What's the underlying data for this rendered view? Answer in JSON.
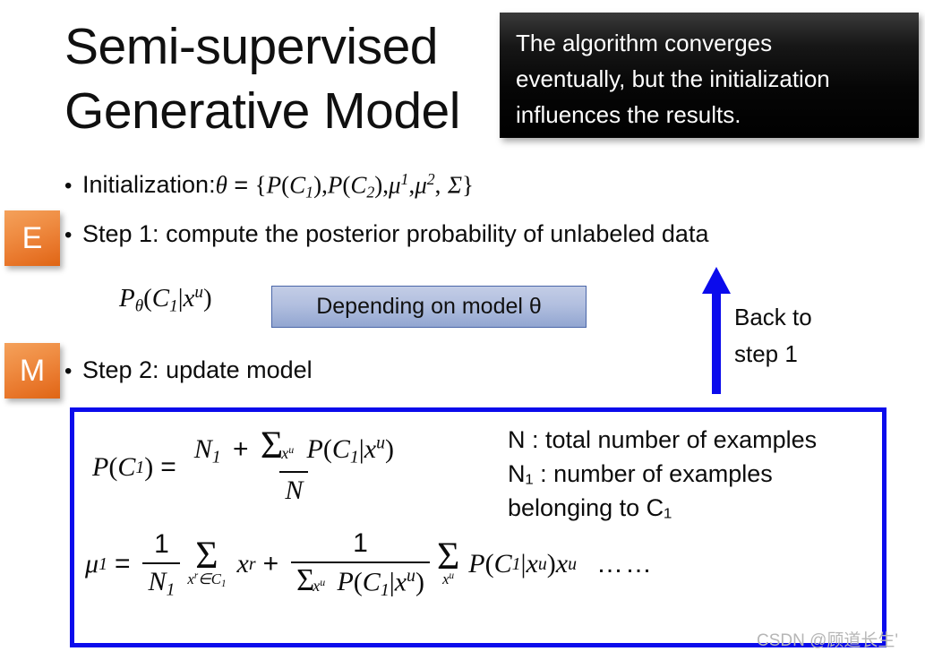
{
  "slide": {
    "title_lines": [
      "Semi-supervised",
      "Generative Model"
    ],
    "callout_lines": [
      "The algorithm converges",
      "eventually, but the initialization",
      "influences the results."
    ],
    "badges": {
      "e": "E",
      "m": "M"
    },
    "bullets": {
      "dot": "•",
      "initialization_label": "Initialization:",
      "initialization_formula": "θ = {P(C₁),P(C₂),μ¹,μ², Σ}",
      "step1": "Step 1: compute the posterior probability of unlabeled data",
      "step2": "Step 2: update model"
    },
    "posterior_formula": "Pθ(C₁|xᵘ)",
    "depending_box": "Depending on model θ",
    "arrow_label_lines": [
      "Back to",
      "step 1"
    ],
    "definitions": [
      "N : total number of examples",
      "N₁ : number of examples",
      "belonging to C₁"
    ],
    "equations": {
      "eq1": "P(C₁) = (N₁ + Σ_{xᵘ} P(C₁|xᵘ)) / N",
      "eq2": "μ¹ = (1/N₁) Σ_{xʳ∈C₁} xʳ + (1/Σ_{xᵘ} P(C₁|xᵘ)) Σ_{xᵘ} P(C₁|xᵘ)xᵘ",
      "ellipsis": "……"
    },
    "math_tokens": {
      "P": "P",
      "C": "C",
      "one": "1",
      "two": "2",
      "N": "N",
      "mu": "μ",
      "theta": "θ",
      "sigma_cap": "Σ",
      "x": "x",
      "u": "u",
      "r": "r",
      "eq": "=",
      "plus": "+",
      "bar": "|",
      "lparen": "(",
      "rparen": ")",
      "lbrace": "{",
      "rbrace": "}",
      "comma": ",",
      "colon": ":",
      "in": "∈",
      "sum": "Σ"
    },
    "watermark": "CSDN @顾道长生'",
    "colors": {
      "badge_orange_light": "#f4a15b",
      "badge_orange_dark": "#df6514",
      "callout_black": "#000000",
      "blue_border": "#0b0bec",
      "depend_box_fill": "#b2bfdf",
      "depend_box_border": "#4a66a8",
      "arrow_blue": "#0b0bec",
      "watermark_gray": "#b6b6b6"
    }
  }
}
